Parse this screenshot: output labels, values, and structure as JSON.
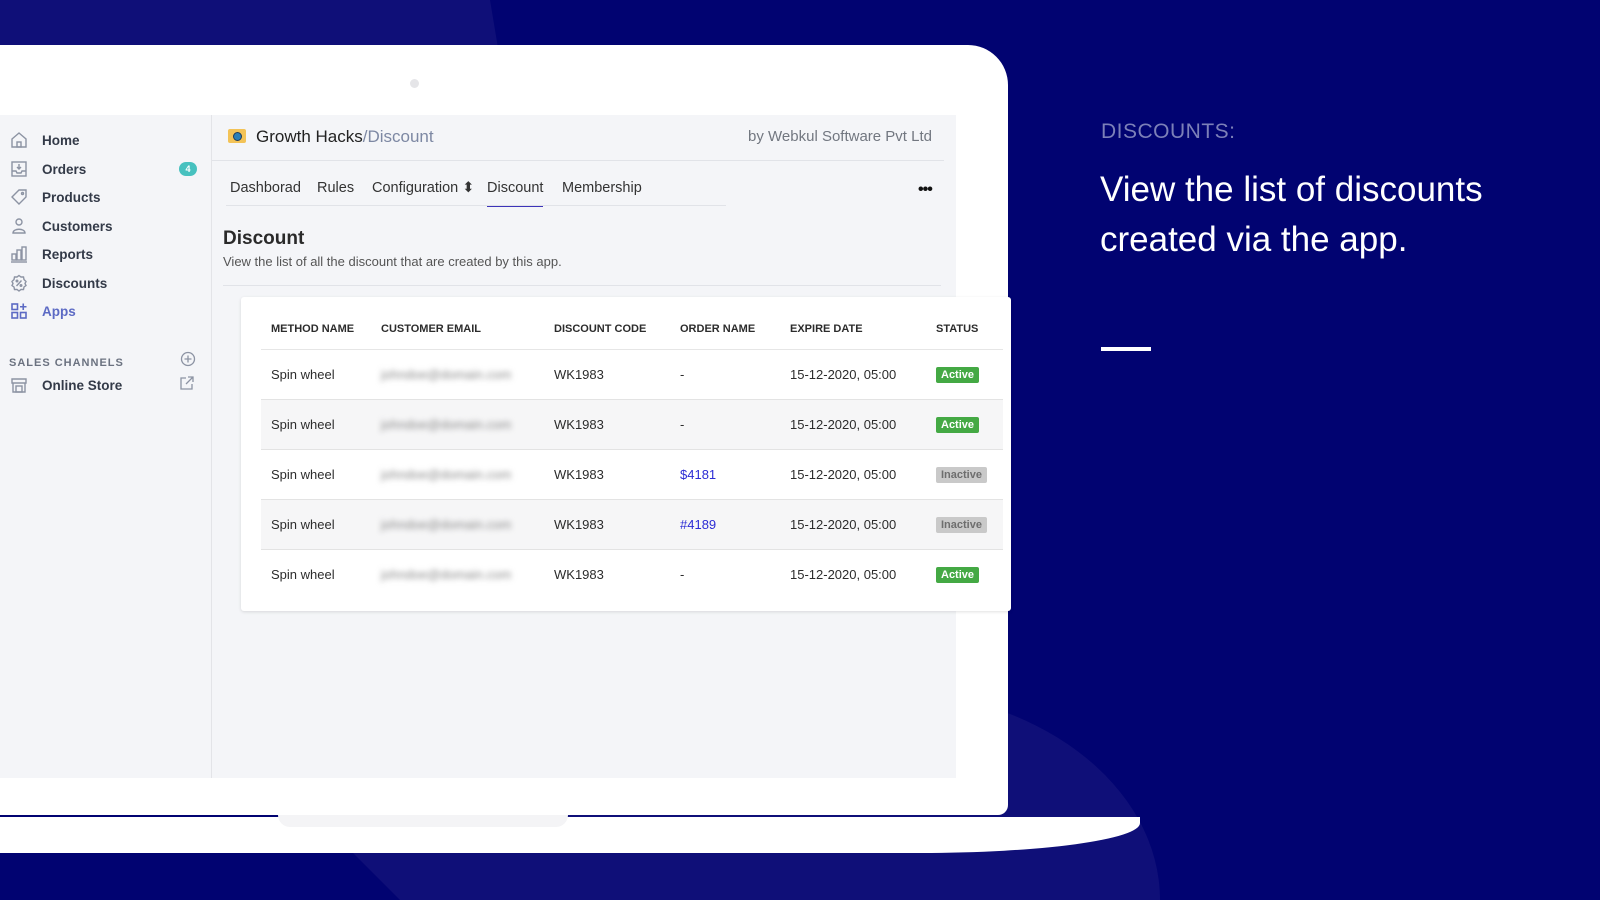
{
  "promo": {
    "kicker": "DISCOUNTS:",
    "headline": "View the list of discounts created via the app."
  },
  "sidebar": {
    "items": [
      {
        "label": "Home",
        "icon": "home-icon"
      },
      {
        "label": "Orders",
        "icon": "orders-icon",
        "badge": "4"
      },
      {
        "label": "Products",
        "icon": "tag-icon"
      },
      {
        "label": "Customers",
        "icon": "person-icon"
      },
      {
        "label": "Reports",
        "icon": "bar-chart-icon"
      },
      {
        "label": "Discounts",
        "icon": "discount-icon"
      },
      {
        "label": "Apps",
        "icon": "apps-icon",
        "active": true
      }
    ],
    "sales_channels_title": "SALES CHANNELS",
    "channels": [
      {
        "label": "Online Store",
        "icon": "store-icon"
      }
    ]
  },
  "app": {
    "title": "Growth Hacks",
    "breadcrumb": "/Discount",
    "by_line": "by Webkul Software Pvt Ltd",
    "tabs": [
      {
        "label": "Dashborad"
      },
      {
        "label": "Rules"
      },
      {
        "label": "Configuration ⬍"
      },
      {
        "label": "Discount",
        "active": true
      },
      {
        "label": "Membership"
      }
    ],
    "more": "•••"
  },
  "section": {
    "title": "Discount",
    "description": "View the list of all the discount that are created by this app."
  },
  "table": {
    "columns": [
      "METHOD NAME",
      "CUSTOMER EMAIL",
      "DISCOUNT CODE",
      "ORDER NAME",
      "EXPIRE DATE",
      "STATUS"
    ],
    "rows": [
      {
        "method": "Spin wheel",
        "email": "johndoe@domain.com",
        "code": "WK1983",
        "order": "-",
        "expire": "15-12-2020, 05:00",
        "status": "Active"
      },
      {
        "method": "Spin wheel",
        "email": "johndoe@domain.com",
        "code": "WK1983",
        "order": "-",
        "expire": "15-12-2020, 05:00",
        "status": "Active"
      },
      {
        "method": "Spin wheel",
        "email": "johndoe@domain.com",
        "code": "WK1983",
        "order": "$4181",
        "expire": "15-12-2020, 05:00",
        "status": "Inactive"
      },
      {
        "method": "Spin wheel",
        "email": "johndoe@domain.com",
        "code": "WK1983",
        "order": "#4189",
        "expire": "15-12-2020, 05:00",
        "status": "Inactive"
      },
      {
        "method": "Spin wheel",
        "email": "johndoe@domain.com",
        "code": "WK1983",
        "order": "-",
        "expire": "15-12-2020, 05:00",
        "status": "Active"
      }
    ]
  },
  "colors": {
    "background": "#010371",
    "accent": "#3d34b9",
    "active_status": "#44a944",
    "inactive_status": "#c9c9c9",
    "link": "#2b2bd4",
    "badge": "#47c1bf"
  }
}
